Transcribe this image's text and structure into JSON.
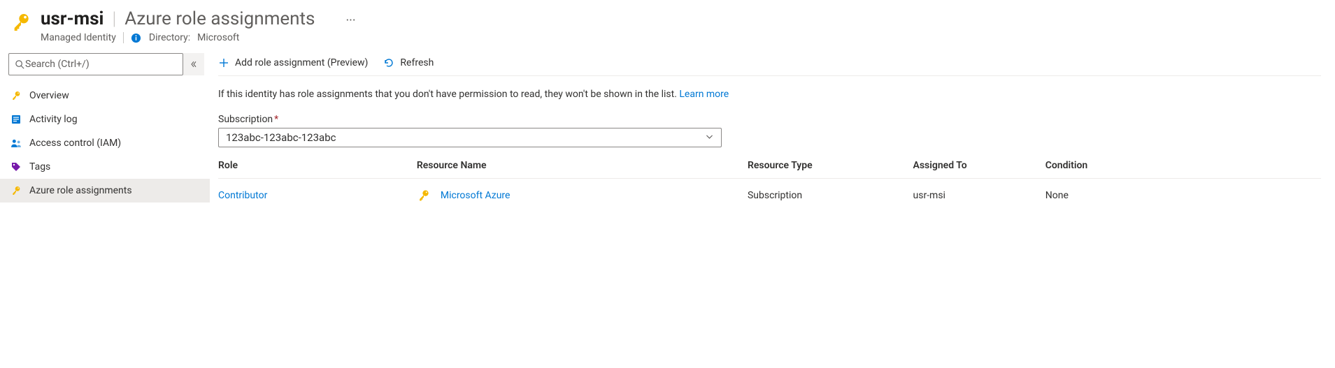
{
  "header": {
    "resource_name": "usr-msi",
    "section_title": "Azure role assignments",
    "resource_type": "Managed Identity",
    "directory_label": "Directory:",
    "directory_value": "Microsoft"
  },
  "sidebar": {
    "search_placeholder": "Search (Ctrl+/)",
    "items": [
      {
        "label": "Overview",
        "icon": "key-icon"
      },
      {
        "label": "Activity log",
        "icon": "log-icon"
      },
      {
        "label": "Access control (IAM)",
        "icon": "people-icon"
      },
      {
        "label": "Tags",
        "icon": "tag-icon"
      },
      {
        "label": "Azure role assignments",
        "icon": "key-icon"
      }
    ]
  },
  "toolbar": {
    "add_label": "Add role assignment (Preview)",
    "refresh_label": "Refresh"
  },
  "description": {
    "text": "If this identity has role assignments that you don't have permission to read, they won't be shown in the list. ",
    "learn_more": "Learn more"
  },
  "subscription": {
    "label": "Subscription",
    "value": "123abc-123abc-123abc"
  },
  "table": {
    "headers": {
      "role": "Role",
      "resource_name": "Resource Name",
      "resource_type": "Resource Type",
      "assigned_to": "Assigned To",
      "condition": "Condition"
    },
    "rows": [
      {
        "role": "Contributor",
        "resource_name": "Microsoft Azure",
        "resource_type": "Subscription",
        "assigned_to": "usr-msi",
        "condition": "None"
      }
    ]
  }
}
